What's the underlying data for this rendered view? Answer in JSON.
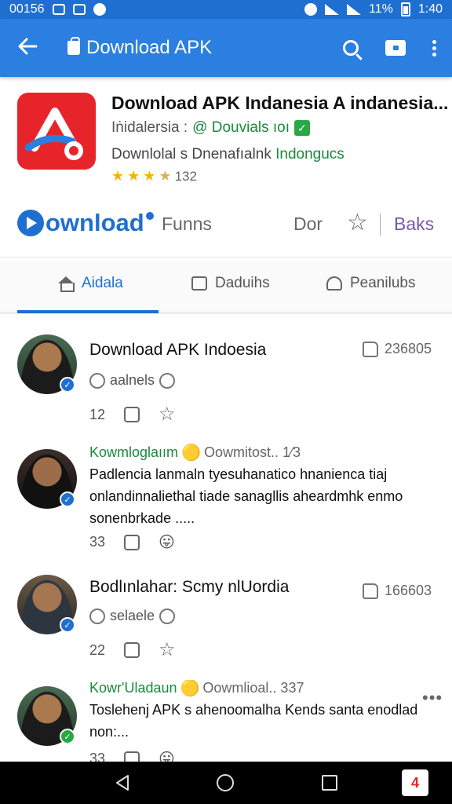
{
  "status_bar": {
    "time_left": "00156",
    "time_right": "1:40",
    "indicator_text": "11%"
  },
  "app_bar": {
    "title": "Download APK"
  },
  "app_header": {
    "name": "Download APK Indanesia A indanesia...",
    "developer": "Iṅidalersia :",
    "developer_link": "@ Douvials ıoı",
    "subtitle_prefix": "Downlolal s Dnenafıalnk",
    "subtitle_green": "Indongucs",
    "rating_count": "132"
  },
  "action_row": {
    "download_label": "ownload",
    "funds_label": "Funns",
    "dor_label": "Dor",
    "baks_label": "Baks"
  },
  "tabs": [
    {
      "label": "Aidala",
      "active": true
    },
    {
      "label": "Daduihs",
      "active": false
    },
    {
      "label": "Peanilubs",
      "active": false
    }
  ],
  "feed": [
    {
      "title": "Download APK Indoesia",
      "meta": "aalnels",
      "likes": "236805",
      "count": "12"
    },
    {
      "user": "Kowmloglaıım",
      "header_rest": "Oowmitost.. 1⁄3",
      "body": "Padlencia lanmaln tyesuhanatico hnanienca tiaj onlandinnaliethal tiade sanagllis aheardmhk enmo sonenbrkade .....",
      "count": "33"
    },
    {
      "title": "Bodlınlahar: Scmy nlUordia",
      "meta": "selaele",
      "likes": "166603",
      "count": "22"
    },
    {
      "user": "Kowr'Uladaun",
      "header_rest": "Oowmlioal.. 337",
      "body": "Toslehenj APK s ahenoomalha Kends santa enodlad non:...",
      "count": "33"
    }
  ],
  "colors": {
    "primary": "#2a7fe0",
    "accent_green": "#1a8a3b",
    "logo_red": "#e8242b",
    "baks_purple": "#7a5aa6"
  }
}
